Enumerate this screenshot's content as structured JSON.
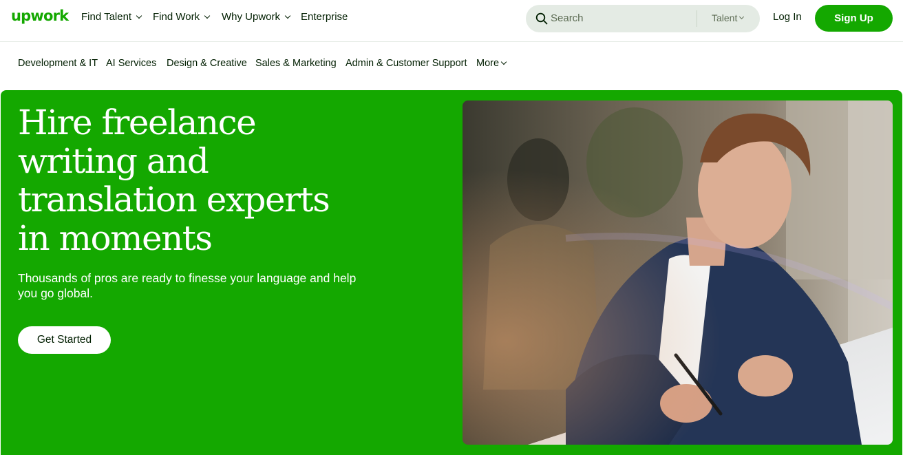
{
  "header": {
    "logo": "upwork",
    "nav": [
      {
        "label": "Find Talent",
        "has_menu": true
      },
      {
        "label": "Find Work",
        "has_menu": true
      },
      {
        "label": "Why Upwork",
        "has_menu": true
      },
      {
        "label": "Enterprise",
        "has_menu": false
      }
    ],
    "search": {
      "placeholder": "Search",
      "scope": "Talent"
    },
    "login": "Log In",
    "signup": "Sign Up"
  },
  "categories": [
    {
      "label": "Development & IT"
    },
    {
      "label": "AI Services"
    },
    {
      "label": "Design & Creative"
    },
    {
      "label": "Sales & Marketing"
    },
    {
      "label": "Admin & Customer Support"
    },
    {
      "label": "More",
      "has_menu": true
    }
  ],
  "hero": {
    "title_lines": [
      "Hire freelance",
      "writing and",
      "translation experts",
      "in moments"
    ],
    "subtitle": "Thousands of pros are ready to finesse your language and help you go global.",
    "cta": "Get Started",
    "image_alt": "man-writing-at-desk-photo"
  },
  "colors": {
    "brand_green": "#14a800",
    "text_dark": "#001e00",
    "search_bg": "#e4ebe4"
  }
}
